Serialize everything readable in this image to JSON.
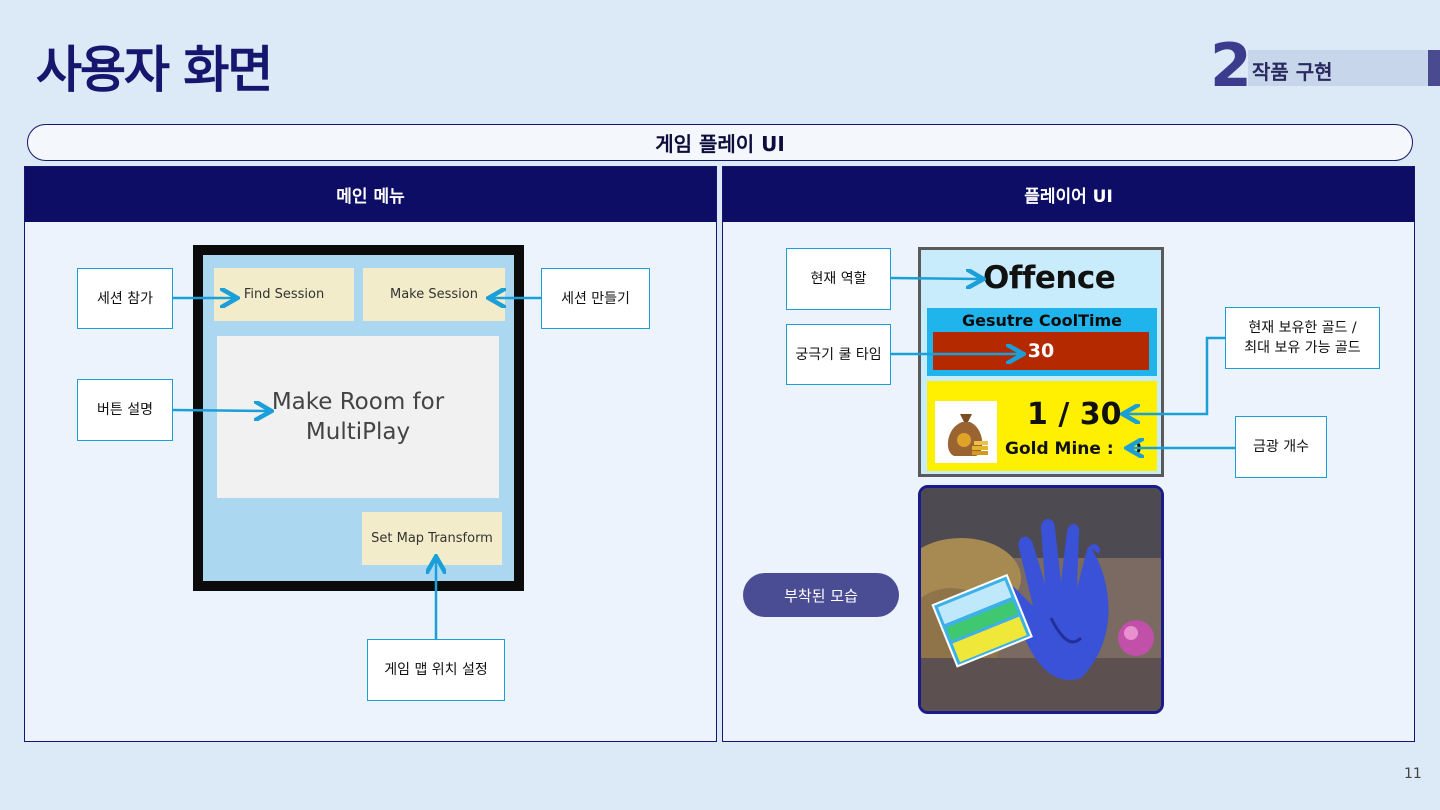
{
  "header": {
    "title": "사용자 화면",
    "section_number": "2",
    "section_label": "작품 구현"
  },
  "subheader": "게임 플레이 UI",
  "left_panel": {
    "title": "메인 메뉴",
    "callouts": {
      "join": "세션 참가",
      "create": "세션 만들기",
      "desc": "버튼 설명",
      "transform": "게임 맵 위치 설정"
    },
    "menu": {
      "find": "Find Session",
      "make": "Make Session",
      "room_line1": "Make Room for",
      "room_line2": "MultiPlay",
      "transform": "Set Map Transform"
    }
  },
  "right_panel": {
    "title": "플레이어 UI",
    "callouts": {
      "role": "현재 역할",
      "cooldown": "궁극기 쿨 타임",
      "gold_line1": "현재 보유한 골드 /",
      "gold_line2": "최대 보유 가능 골드",
      "mine": "금광 개수"
    },
    "hud": {
      "role": "Offence",
      "cooldown_label": "Gesutre CoolTime",
      "cooldown_value": "30",
      "gold": "1 / 30",
      "mine_label": "Gold Mine :",
      "mine_value": "0"
    },
    "attached_label": "부착된 모습"
  },
  "page_number": "11",
  "colors": {
    "navy": "#0d0d66",
    "accent_blue": "#1b9fd9",
    "menu_bg": "#abd8f0",
    "cool_red": "#b52900",
    "gold_yellow": "#ffef00"
  }
}
